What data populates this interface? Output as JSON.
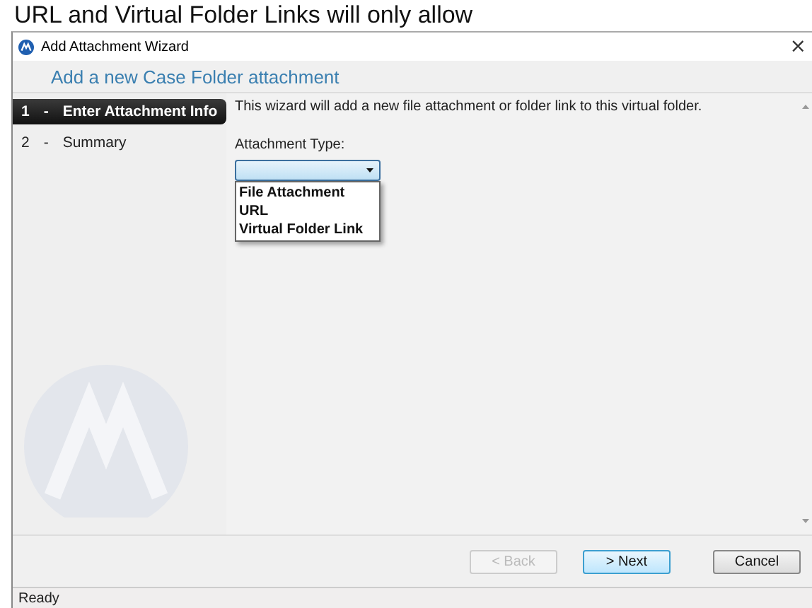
{
  "background_text": "URL and Virtual Folder Links will only allow",
  "window": {
    "title": "Add Attachment Wizard",
    "close": "×"
  },
  "header": {
    "title": "Add a new Case Folder attachment"
  },
  "steps": [
    {
      "number": "1",
      "separator": "-",
      "label": "Enter Attachment Info",
      "selected": true
    },
    {
      "number": "2",
      "separator": "-",
      "label": "Summary",
      "selected": false
    }
  ],
  "intro": "This wizard will add a new file attachment or folder link to this virtual folder.",
  "attachment_type": {
    "label": "Attachment Type:",
    "expanded": true,
    "options": [
      "File Attachment",
      "URL",
      "Virtual Folder Link"
    ]
  },
  "buttons": [
    {
      "label": "< Back",
      "disabled": true,
      "default": false
    },
    {
      "label": "> Next",
      "disabled": false,
      "default": true
    },
    {
      "label": "Cancel",
      "disabled": false,
      "default": false
    }
  ],
  "status_bar": "Ready"
}
